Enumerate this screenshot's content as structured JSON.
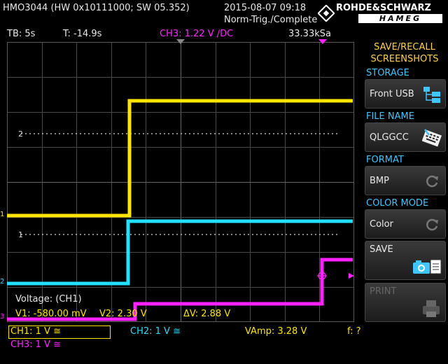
{
  "header": {
    "device": "HMO3044 (HW 0x10111000; SW 05.352)",
    "datetime": "2015-08-07 09:18",
    "trigger_status": "Norm-Trig./Complete",
    "brand": "ROHDE&SCHWARZ",
    "brand_sub": "HAMEG"
  },
  "status": {
    "timebase": "TB: 5s",
    "trigger_time": "T: -14.9s",
    "trigger_source": "CH3: 1.22 V ∕DC",
    "sample_rate": "33.33kSa"
  },
  "colors": {
    "ch1": "#ffe600",
    "ch2": "#22e0ff",
    "ch3": "#ff22ff",
    "menu_title": "#ffd24d",
    "section_label": "#3ec6ff"
  },
  "sidebar": {
    "menu_title_line1": "SAVE/RECALL",
    "menu_title_line2": "SCREENSHOTS",
    "storage_label": "STORAGE",
    "storage_value": "Front USB",
    "storage_icon": "usb-folder-icon",
    "filename_label": "FILE NAME",
    "filename_value": "QLGGCC",
    "filename_icon": "keyboard-edit-icon",
    "format_label": "FORMAT",
    "format_value": "BMP",
    "format_icon": "cycle-icon",
    "colormode_label": "COLOR MODE",
    "colormode_value": "Color",
    "colormode_icon": "cycle-icon",
    "save_label": "SAVE",
    "save_icon": "camera-icon",
    "print_label": "PRINT",
    "print_icon": "printer-icon"
  },
  "cursor": {
    "title": "Voltage: (CH1)",
    "v1": "V1: -580.00 mV",
    "v2": "V2: 2.30 V",
    "dv": "ΔV: 2.88 V"
  },
  "bottom": {
    "ch1": "CH1: 1 V ≅",
    "ch2": "CH2: 1 V ≅",
    "ch3": "CH3: 1 V ≅",
    "vamp": "VAmp: 3.28 V",
    "freq": "f: ?"
  },
  "markers": {
    "ch1_ref": "1",
    "ch2_ref": "2",
    "cursor1": "1",
    "cursor2": "2",
    "ch3_ref": "3"
  }
}
